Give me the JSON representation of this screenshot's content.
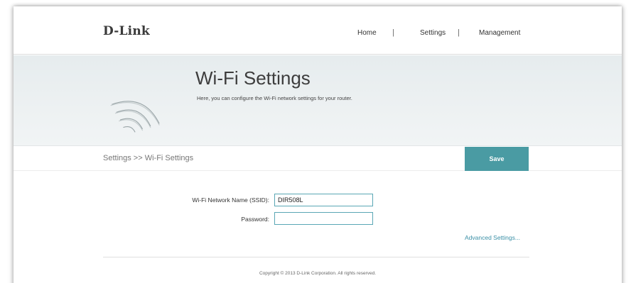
{
  "brand": {
    "logo": "D-Link"
  },
  "nav": {
    "home": "Home",
    "settings": "Settings",
    "management": "Management",
    "separator": "|"
  },
  "hero": {
    "title": "Wi-Fi Settings",
    "description": "Here, you can configure the Wi-Fi network settings for your router.",
    "icon": "wifi-icon"
  },
  "breadcrumb": {
    "text": "Settings >> Wi-Fi Settings"
  },
  "actions": {
    "save_label": "Save"
  },
  "form": {
    "ssid_label": "Wi-Fi Network Name (SSID):",
    "ssid_value": "DIR508L",
    "password_label": "Password:",
    "password_value": ""
  },
  "links": {
    "advanced": "Advanced Settings..."
  },
  "footer": {
    "copyright": "Copyright © 2013 D-Link Corporation. All rights reserved."
  },
  "colors": {
    "accent": "#4a9ba3",
    "link": "#3a8fa6",
    "field_border": "#5aa7b5"
  }
}
